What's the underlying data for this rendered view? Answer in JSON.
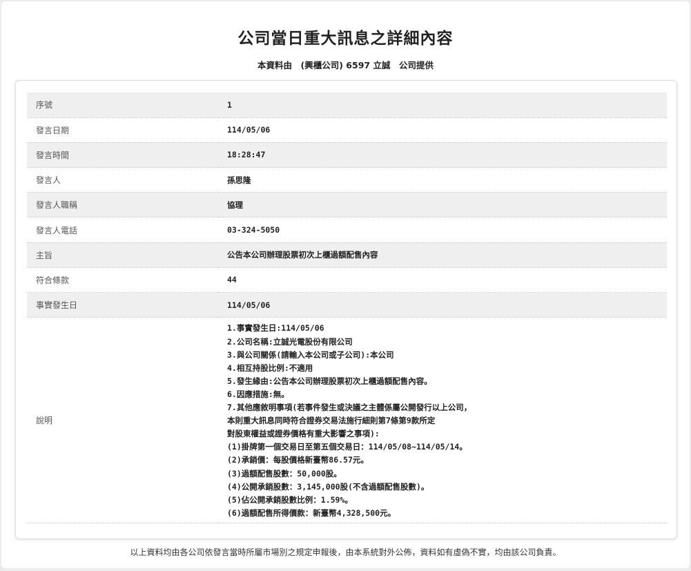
{
  "page": {
    "title": "公司當日重大訊息之詳細內容",
    "subtitle": "本資料由　(興櫃公司) 6597 立誠　公司提供",
    "footer": "以上資料均由各公司依發言當時所屬市場別之規定申報後，由本系統對外公佈，資料如有虛偽不實，均由該公司負責。"
  },
  "rows": [
    {
      "label": "序號",
      "value": "1"
    },
    {
      "label": "發言日期",
      "value": "114/05/06"
    },
    {
      "label": "發言時間",
      "value": "18:28:47"
    },
    {
      "label": "發言人",
      "value": "孫思隆"
    },
    {
      "label": "發言人職稱",
      "value": "協理"
    },
    {
      "label": "發言人電話",
      "value": "03-324-5050"
    },
    {
      "label": "主旨",
      "value": "公告本公司辦理股票初次上櫃過額配售內容"
    },
    {
      "label": "符合條款",
      "value": "44"
    },
    {
      "label": "事實發生日",
      "value": "114/05/06"
    }
  ],
  "description": {
    "label": "說明",
    "lines": [
      "1.事實發生日:114/05/06",
      "2.公司名稱:立誠光電股份有限公司",
      "3.與公司關係(請輸入本公司或子公司):本公司",
      "4.相互持股比例:不適用",
      "5.發生緣由:公告本公司辦理股票初次上櫃過額配售內容。",
      "6.因應措施:無。",
      "7.其他應敘明事項(若事件發生或決議之主體係屬公開發行以上公司，",
      "本則重大訊息同時符合證券交易法施行細則第7條第9款所定",
      "對股東權益或證券價格有重大影響之事項):",
      "(1)掛牌第一個交易日至第五個交易日：114/05/08~114/05/14。",
      "(2)承銷價：每股價格新臺幣86.57元。",
      "(3)過額配售股數：50,000股。",
      "(4)公開承銷股數：3,145,000股(不含過額配售股數)。",
      "(5)佔公開承銷股數比例：1.59%。",
      "(6)過額配售所得價款：新臺幣4,328,500元。"
    ]
  }
}
